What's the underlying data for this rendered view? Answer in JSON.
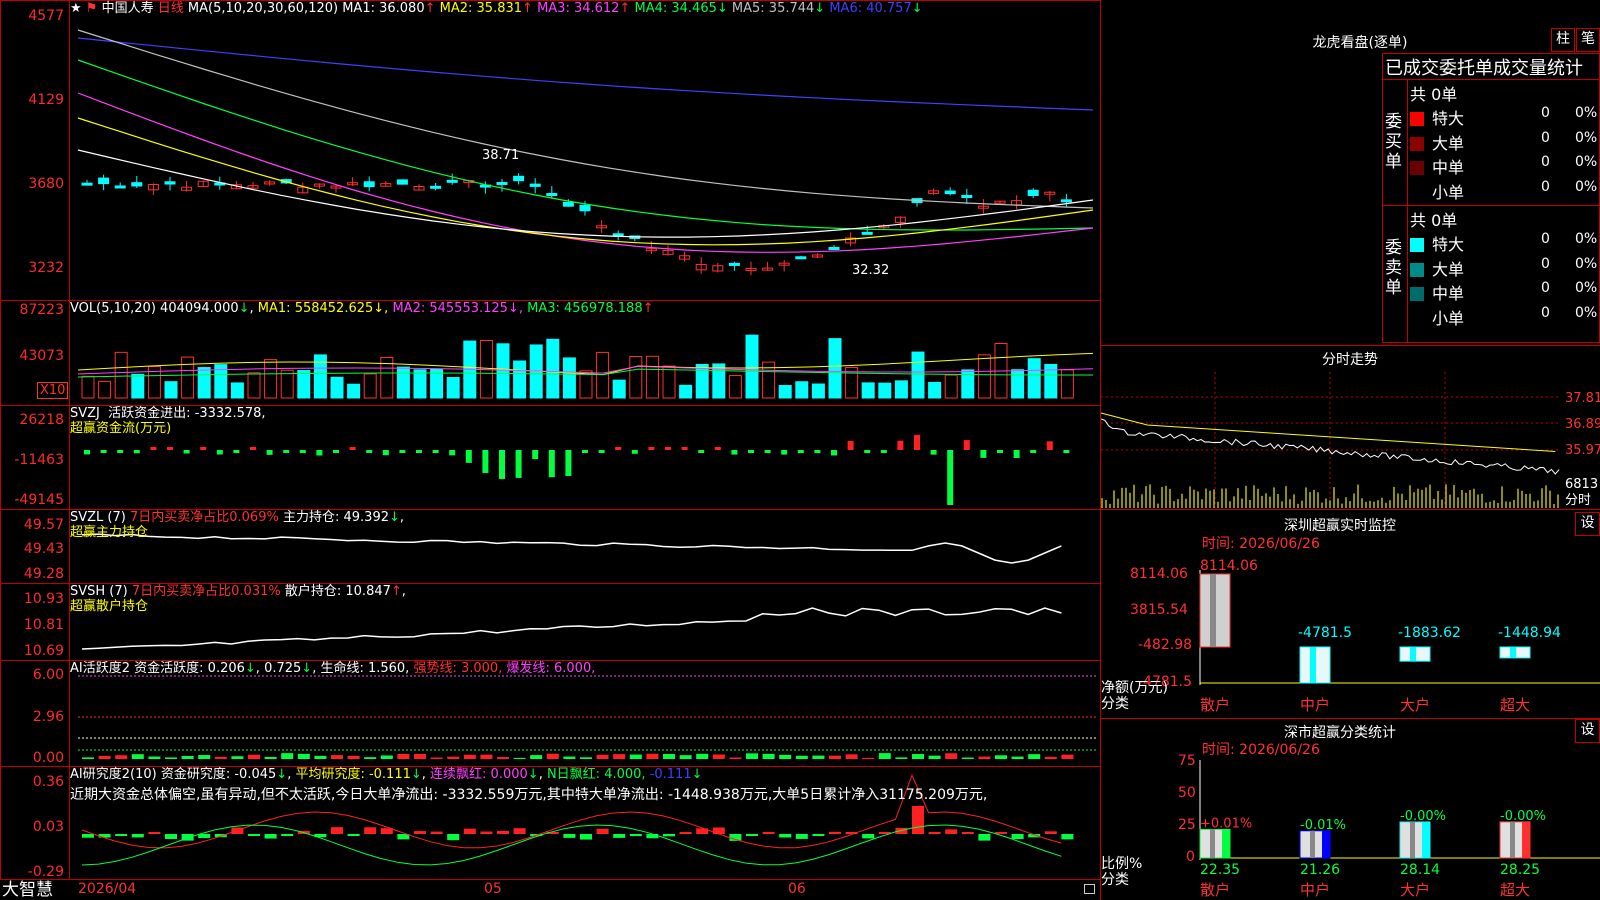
{
  "main": {
    "stock_name": "中国人寿",
    "period": "日线",
    "ma_params": "MA(5,10,20,30,60,120)",
    "ma": [
      {
        "label": "MA1:",
        "value": "36.080",
        "arrow": "↑",
        "color": "#ffffff"
      },
      {
        "label": "MA2:",
        "value": "35.831",
        "arrow": "↑",
        "color": "#ffff00"
      },
      {
        "label": "MA3:",
        "value": "34.612",
        "arrow": "↑",
        "color": "#ff40ff"
      },
      {
        "label": "MA4:",
        "value": "34.465",
        "arrow": "↓",
        "color": "#00ff40"
      },
      {
        "label": "MA5:",
        "value": "35.744",
        "arrow": "↓",
        "color": "#c0c0c0"
      },
      {
        "label": "MA6:",
        "value": "40.757",
        "arrow": "↓",
        "color": "#4040ff"
      }
    ],
    "y_ticks": [
      "4577",
      "4129",
      "3680",
      "3232"
    ],
    "high_label": "38.71",
    "low_label": "32.32"
  },
  "vol": {
    "title": "VOL(5,10,20)",
    "value": "404094.000",
    "ma1": "558452.625",
    "ma2": "545553.125",
    "ma3": "456978.188",
    "y_ticks": [
      "87223",
      "43073"
    ],
    "unit": "X10"
  },
  "svzj": {
    "title": "SVZJ",
    "label": "活跃资金进出:",
    "value": "-3332.578",
    "sub": "超赢资金流(万元)",
    "y_ticks": [
      "26218",
      "-11463",
      "-49145"
    ]
  },
  "svzl": {
    "title": "SVZL (7)",
    "sub_red": "7日内买卖净占比0.069%",
    "label": "主力持仓:",
    "value": "49.392",
    "sub": "超赢主力持仓",
    "y_ticks": [
      "49.57",
      "49.43",
      "49.28"
    ]
  },
  "svsh": {
    "title": "SVSH (7)",
    "sub_red": "7日内买卖净占比0.031%",
    "label": "散户持仓:",
    "value": "10.847",
    "sub": "超赢散户持仓",
    "y_ticks": [
      "10.93",
      "10.81",
      "10.69"
    ]
  },
  "ai1": {
    "title": "AI活跃度2",
    "label": "资金活跃度:",
    "v1": "0.206",
    "v2": "0.725",
    "life": "生命线: 1.560,",
    "strong": "强势线: 3.000,",
    "burst": "爆发线: 6.000,",
    "y_ticks": [
      "6.00",
      "2.96",
      "0.00"
    ]
  },
  "ai2": {
    "title": "AI研究度2(10)",
    "label": "资金研究度:",
    "v1": "-0.045",
    "avg": "平均研究度: -0.111",
    "streak": "连续飘红: 0.000",
    "n": "N日飘红: 4.000,",
    "v2": "-0.111",
    "comment": "近期大资金总体偏空,虽有异动,但不太活跃,今日大单净流出: -3332.559万元,其中特大单净流出: -1448.938万元,大单5日累计净入31175.209万元,",
    "y_ticks": [
      "0.36",
      "0.03",
      "-0.29"
    ]
  },
  "bottom": {
    "brand": "大智慧",
    "dates": [
      "2026/04",
      "05",
      "06"
    ]
  },
  "right": {
    "lhkp_title": "龙虎看盘(逐单)",
    "btn_zhu": "柱",
    "btn_bi": "笔",
    "stat_title": "已成交委托单成交量统计",
    "buy": {
      "side": "委买单",
      "total": "共 0单",
      "rows": [
        {
          "label": "特大",
          "count": "0",
          "pct": "0%",
          "color": "#ff0000"
        },
        {
          "label": "大单",
          "count": "0",
          "pct": "0%",
          "color": "#8b0000"
        },
        {
          "label": "中单",
          "count": "0",
          "pct": "0%",
          "color": "#6b0000"
        },
        {
          "label": "小单",
          "count": "0",
          "pct": "0%",
          "color": "#000000"
        }
      ]
    },
    "sell": {
      "side": "委卖单",
      "total": "共 0单",
      "rows": [
        {
          "label": "特大",
          "count": "0",
          "pct": "0%",
          "color": "#00ffff"
        },
        {
          "label": "大单",
          "count": "0",
          "pct": "0%",
          "color": "#008b8b"
        },
        {
          "label": "中单",
          "count": "0",
          "pct": "0%",
          "color": "#006b6b"
        },
        {
          "label": "小单",
          "count": "0",
          "pct": "0%",
          "color": "#000000"
        }
      ]
    },
    "intraday_title": "分时走势",
    "intraday_ticks": [
      "37.81",
      "36.89",
      "35.97"
    ],
    "intraday_vol": "6813",
    "intraday_label": "分时",
    "sz_title": "深圳超赢实时监控",
    "settings": "设",
    "sz_time": "时间: 2026/06/26",
    "sz_ticks": [
      "8114.06",
      "3815.54",
      "-482.98",
      "-4781.5"
    ],
    "sz_ylabel": "净额(万元)",
    "sz_xlabel": "分类",
    "sz_cats": [
      "散户",
      "中户",
      "大户",
      "超大"
    ],
    "sz_values": [
      8114.06,
      -4781.5,
      -1883.62,
      -1448.94
    ],
    "sz_value_labels": [
      "8114.06",
      "-4781.5",
      "-1883.62",
      "-1448.94"
    ],
    "fl_title": "深市超赢分类统计",
    "fl_time": "时间: 2026/06/26",
    "fl_ticks": [
      "75",
      "50",
      "25",
      "0"
    ],
    "fl_ylabel": "比例%",
    "fl_xlabel": "分类",
    "fl_cats": [
      "散户",
      "中户",
      "大户",
      "超大"
    ],
    "fl_values": [
      22.35,
      21.26,
      28.14,
      28.25
    ],
    "fl_changes": [
      "+0.01%",
      "-0.01%",
      "-0.00%",
      "-0.00%"
    ]
  },
  "chart_data": [
    {
      "type": "bar",
      "title": "深圳超赢实时监控",
      "categories": [
        "散户",
        "中户",
        "大户",
        "超大"
      ],
      "values": [
        8114.06,
        -4781.5,
        -1883.62,
        -1448.94
      ],
      "ylabel": "净额(万元)",
      "xlabel": "分类",
      "ylim": [
        -4781.5,
        8114.06
      ]
    },
    {
      "type": "bar",
      "title": "深市超赢分类统计",
      "categories": [
        "散户",
        "中户",
        "大户",
        "超大"
      ],
      "values": [
        22.35,
        21.26,
        28.14,
        28.25
      ],
      "ylabel": "比例%",
      "xlabel": "分类",
      "ylim": [
        0,
        75
      ]
    }
  ]
}
